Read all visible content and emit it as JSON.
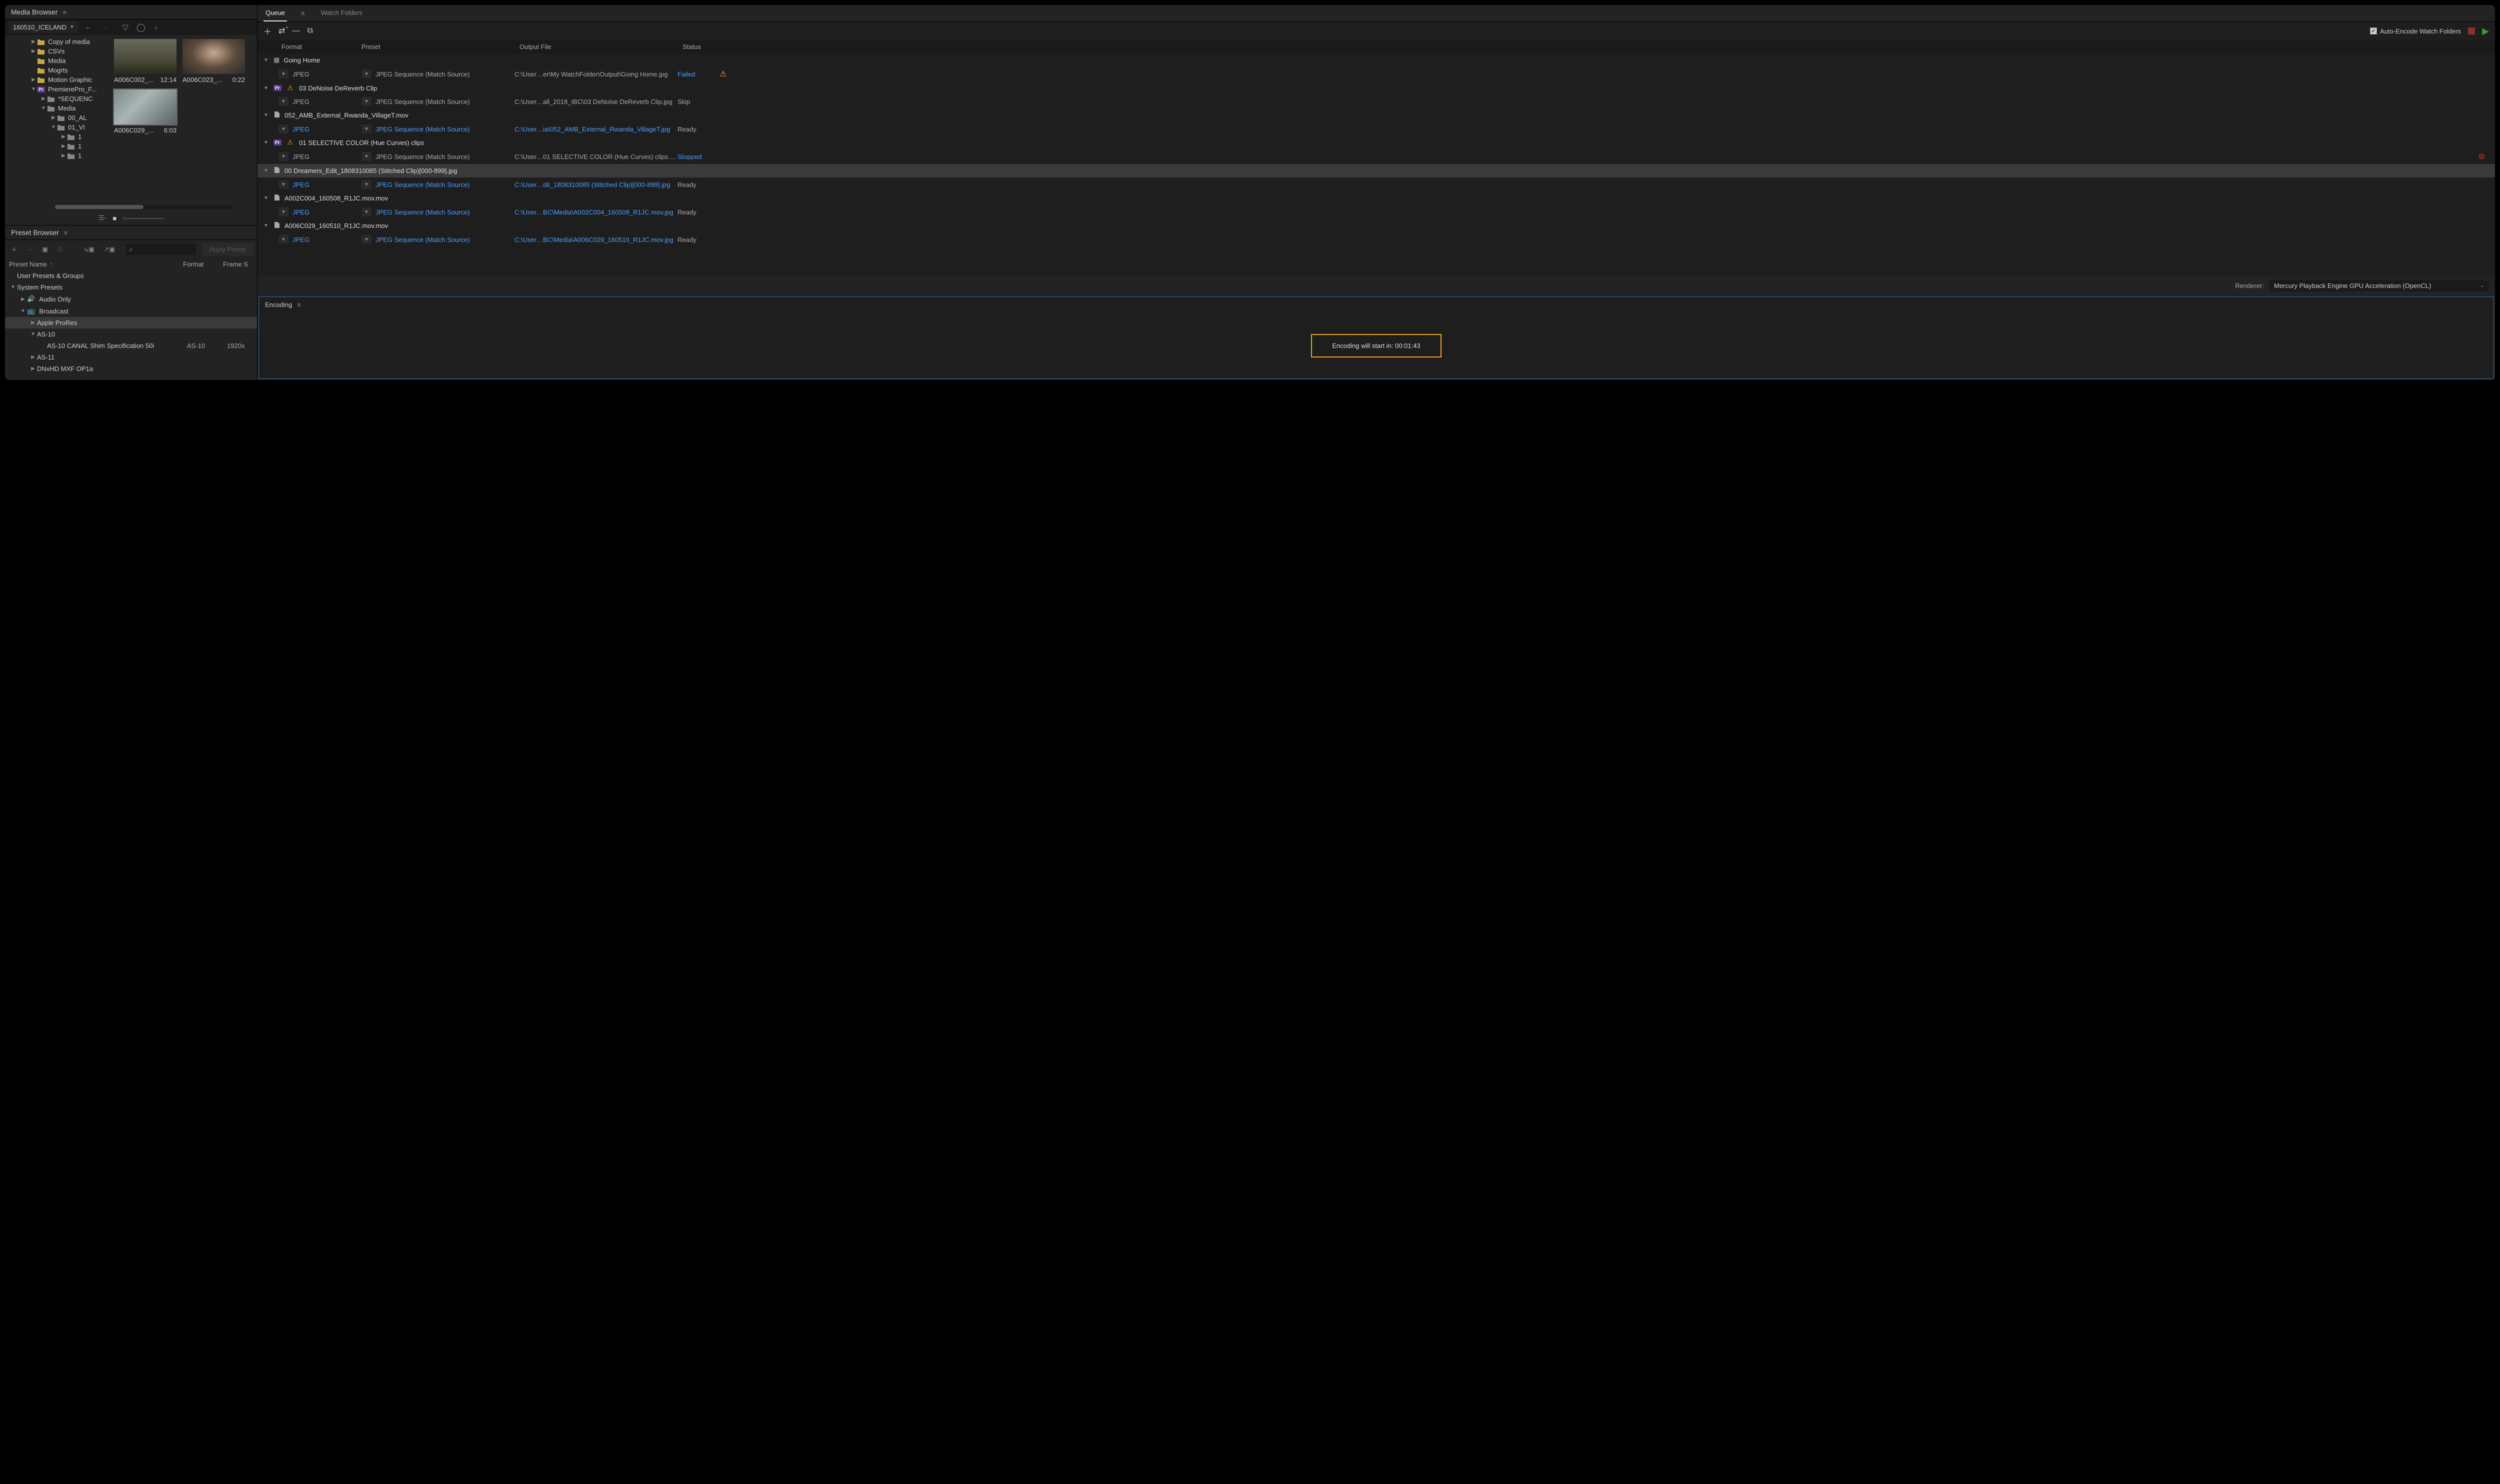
{
  "mediaBrowser": {
    "title": "Media Browser",
    "dropdown": "160510_ICELAND",
    "tree": [
      {
        "label": "Copy of media",
        "indent": 1,
        "icon": "folder",
        "arrow": "right"
      },
      {
        "label": "CSVs",
        "indent": 1,
        "icon": "folder",
        "arrow": "right"
      },
      {
        "label": "Media",
        "indent": 1,
        "icon": "folder",
        "arrow": "none"
      },
      {
        "label": "Mogrts",
        "indent": 1,
        "icon": "folder",
        "arrow": "none"
      },
      {
        "label": "Motion Graphic",
        "indent": 1,
        "icon": "folder",
        "arrow": "right"
      },
      {
        "label": "PremierePro_F...",
        "indent": 1,
        "icon": "pr",
        "arrow": "down"
      },
      {
        "label": "*SEQUENC",
        "indent": 2,
        "icon": "folder-grey",
        "arrow": "right"
      },
      {
        "label": "Media",
        "indent": 2,
        "icon": "folder-grey",
        "arrow": "down"
      },
      {
        "label": "00_AL",
        "indent": 3,
        "icon": "folder-grey",
        "arrow": "right"
      },
      {
        "label": "01_VI",
        "indent": 3,
        "icon": "folder-grey",
        "arrow": "down"
      },
      {
        "label": "1",
        "indent": 4,
        "icon": "folder-grey",
        "arrow": "right"
      },
      {
        "label": "1",
        "indent": 4,
        "icon": "folder-grey",
        "arrow": "right"
      },
      {
        "label": "1",
        "indent": 4,
        "icon": "folder-grey",
        "arrow": "right"
      }
    ],
    "thumbs": [
      {
        "name": "A006C002_...",
        "dur": "12:14",
        "cls": "thumb-1"
      },
      {
        "name": "A006C023_...",
        "dur": "0:22",
        "cls": "thumb-2"
      },
      {
        "name": "A006C029_...",
        "dur": "6:03",
        "cls": "thumb-3",
        "selected": true
      }
    ]
  },
  "presetBrowser": {
    "title": "Preset Browser",
    "applyLabel": "Apply Preset",
    "headers": {
      "name": "Preset Name",
      "format": "Format",
      "fs": "Frame S"
    },
    "rows": [
      {
        "label": "User Presets & Groups",
        "indent": 0,
        "arrow": "none"
      },
      {
        "label": "System Presets",
        "indent": 1,
        "arrow": "down"
      },
      {
        "label": "Audio Only",
        "indent": 2,
        "arrow": "right",
        "icon": "audio"
      },
      {
        "label": "Broadcast",
        "indent": 2,
        "arrow": "down",
        "icon": "tv"
      },
      {
        "label": "Apple ProRes",
        "indent": 3,
        "arrow": "right",
        "selected": true
      },
      {
        "label": "AS-10",
        "indent": 3,
        "arrow": "down"
      },
      {
        "label": "AS-10 CANAL Shim Specification 50i",
        "indent": 4,
        "arrow": "none",
        "format": "AS-10",
        "fs": "1920x"
      },
      {
        "label": "AS-11",
        "indent": 3,
        "arrow": "right"
      },
      {
        "label": "DNxHD MXF OP1a",
        "indent": 3,
        "arrow": "right"
      }
    ]
  },
  "queue": {
    "tabs": {
      "queue": "Queue",
      "watch": "Watch Folders"
    },
    "autoEncode": "Auto-Encode Watch Folders",
    "headers": {
      "format": "Format",
      "preset": "Preset",
      "output": "Output File",
      "status": "Status"
    },
    "items": [
      {
        "type": "group",
        "icon": "proj",
        "label": "Going Home"
      },
      {
        "type": "item",
        "format": "JPEG",
        "preset": "JPEG Sequence (Match Source)",
        "output": "C:\\User…er\\My WatchFolder\\Output\\Going Home.jpg",
        "status": "Failed",
        "statusCls": "status-failed",
        "statusIcon": "warn"
      },
      {
        "type": "group",
        "icon": "pr",
        "warn": true,
        "label": "03 DeNoise DeReverb Clip"
      },
      {
        "type": "item",
        "format": "JPEG",
        "preset": "JPEG Sequence (Match Source)",
        "output": "C:\\User…all_2018_IBC\\03 DeNoise DeReverb Clip.jpg",
        "status": "Skip"
      },
      {
        "type": "group",
        "icon": "file",
        "label": "052_AMB_External_Rwanda_VillageT.mov"
      },
      {
        "type": "item",
        "format": "JPEG",
        "preset": "JPEG Sequence (Match Source)",
        "output": "C:\\User…ia\\052_AMB_External_Rwanda_VillageT.jpg",
        "status": "Ready",
        "link": true
      },
      {
        "type": "group",
        "icon": "pr",
        "warn": true,
        "label": "01 SELECTIVE COLOR (Hue Curves) clips"
      },
      {
        "type": "item",
        "format": "JPEG",
        "preset": "JPEG Sequence (Match Source)",
        "output": "C:\\User…01 SELECTIVE COLOR (Hue Curves) clips.jpg",
        "status": "Stopped",
        "statusCls": "status-stopped",
        "statusIcon": "no"
      },
      {
        "type": "group",
        "icon": "file",
        "label": "00 Dreamers_Edit_1808310085 (Stitched Clip)[000-899].jpg",
        "selected": true
      },
      {
        "type": "item",
        "format": "JPEG",
        "preset": "JPEG Sequence (Match Source)",
        "output": "C:\\User…dit_1808310085 (Stitched Clip)[000-899].jpg",
        "status": "Ready",
        "link": true
      },
      {
        "type": "group",
        "icon": "file",
        "label": "A002C004_160508_R1JC.mov.mov"
      },
      {
        "type": "item",
        "format": "JPEG",
        "preset": "JPEG Sequence (Match Source)",
        "output": "C:\\User…BC\\Media\\A002C004_160508_R1JC.mov.jpg",
        "status": "Ready",
        "link": true
      },
      {
        "type": "group",
        "icon": "file",
        "label": "A006C029_160510_R1JC.mov.mov"
      },
      {
        "type": "item",
        "format": "JPEG",
        "preset": "JPEG Sequence (Match Source)",
        "output": "C:\\User…BC\\Media\\A006C029_160510_R1JC.mov.jpg",
        "status": "Ready",
        "link": true
      }
    ],
    "renderer": {
      "label": "Renderer:",
      "value": "Mercury Playback Engine GPU Acceleration (OpenCL)"
    }
  },
  "encoding": {
    "title": "Encoding",
    "message": "Encoding will start in: 00:01:43"
  }
}
